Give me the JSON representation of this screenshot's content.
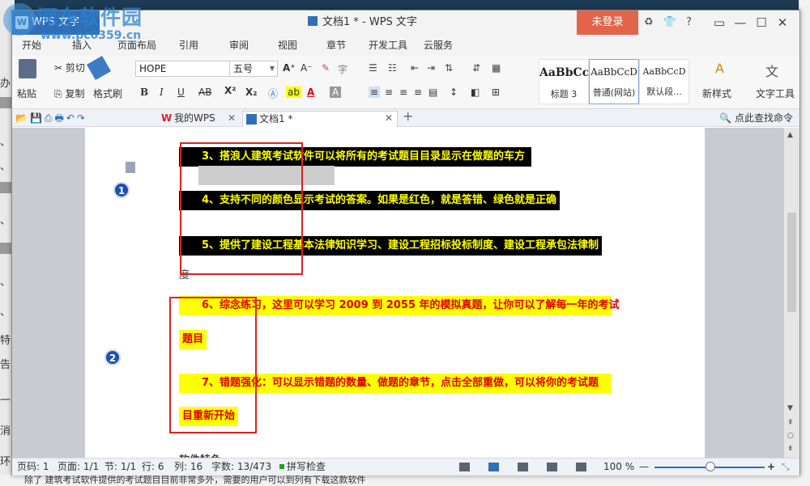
{
  "background": {
    "left_chars": [
      "办",
      "、",
      "、",
      "、",
      "、",
      "、",
      "、",
      "、",
      "特",
      "告",
      "一",
      "消",
      "环"
    ],
    "bottom_text": "除了 建筑考试软件提供的考试题目目前非常多外，需要的用户可以到列有下载这款软件"
  },
  "watermark": {
    "title": "河东软件园",
    "url": "www.pc0359.cn"
  },
  "titlebar": {
    "app_tab": "WPS 文字",
    "app_logo": "W",
    "doc_title": "文档1 * - WPS 文字",
    "login": "未登录",
    "icons": [
      "skin-icon",
      "shirt-icon",
      "help-icon"
    ],
    "help": "?",
    "win_controls": [
      "▭",
      "—",
      "☐",
      "✕"
    ]
  },
  "menu": [
    "开始",
    "插入",
    "页面布局",
    "引用",
    "审阅",
    "视图",
    "章节",
    "开发工具",
    "云服务"
  ],
  "ribbon": {
    "paste": "粘贴",
    "cut": "剪切",
    "copy": "复制",
    "format_painter": "格式刷",
    "font_name": "HOPE",
    "font_size": "五号",
    "bold": "B",
    "italic": "I",
    "underline": "U",
    "strike": "AB",
    "superscript": "X²",
    "subscript": "X₂",
    "font_color": "A",
    "grow": "A⁺",
    "shrink": "A⁻",
    "styles": [
      {
        "sample": "AaBbCcI",
        "label": "标题 3"
      },
      {
        "sample": "AaBbCcD",
        "label": "普通(网站)"
      },
      {
        "sample": "AaBbCcD",
        "label": "默认段..."
      }
    ],
    "new_style": "新样式",
    "text_tools": "文字工具"
  },
  "tabs": {
    "wps_tab": "我的WPS",
    "doc_tab": "文档1 *",
    "close": "✕",
    "add": "+",
    "find": "点此查找命令"
  },
  "document": {
    "lines": [
      "3、搭浪人建筑考试软件可以将所有的考试题目目录显示在做题的车方",
      "4、支持不同的颜色显示考试的答案。如果是红色，就是答错、绿色就是正确",
      "5、提供了建设工程基本法律知识学习、建设工程招标投标制度、建设工程承包法律制",
      "度",
      "6、综念练习，这里可以学习 2009 到 2055 年的模拟真题，让你可以了解每一年的考试",
      "题目",
      "7、错题强化：可以显示错题的数量、做题的章节，点击全部重做，可以将你的考试题",
      "目重新开始",
      "软件特色"
    ],
    "badges": [
      "1",
      "2"
    ]
  },
  "status": {
    "page_code": "页码: 1",
    "pages": "页面: 1/1",
    "section": "节: 1/1",
    "row": "行: 6",
    "col": "列: 16",
    "words": "字数: 13/473",
    "spell": "拼写检查",
    "zoom": "100 %",
    "zoom_minus": "—",
    "zoom_plus": "+"
  }
}
